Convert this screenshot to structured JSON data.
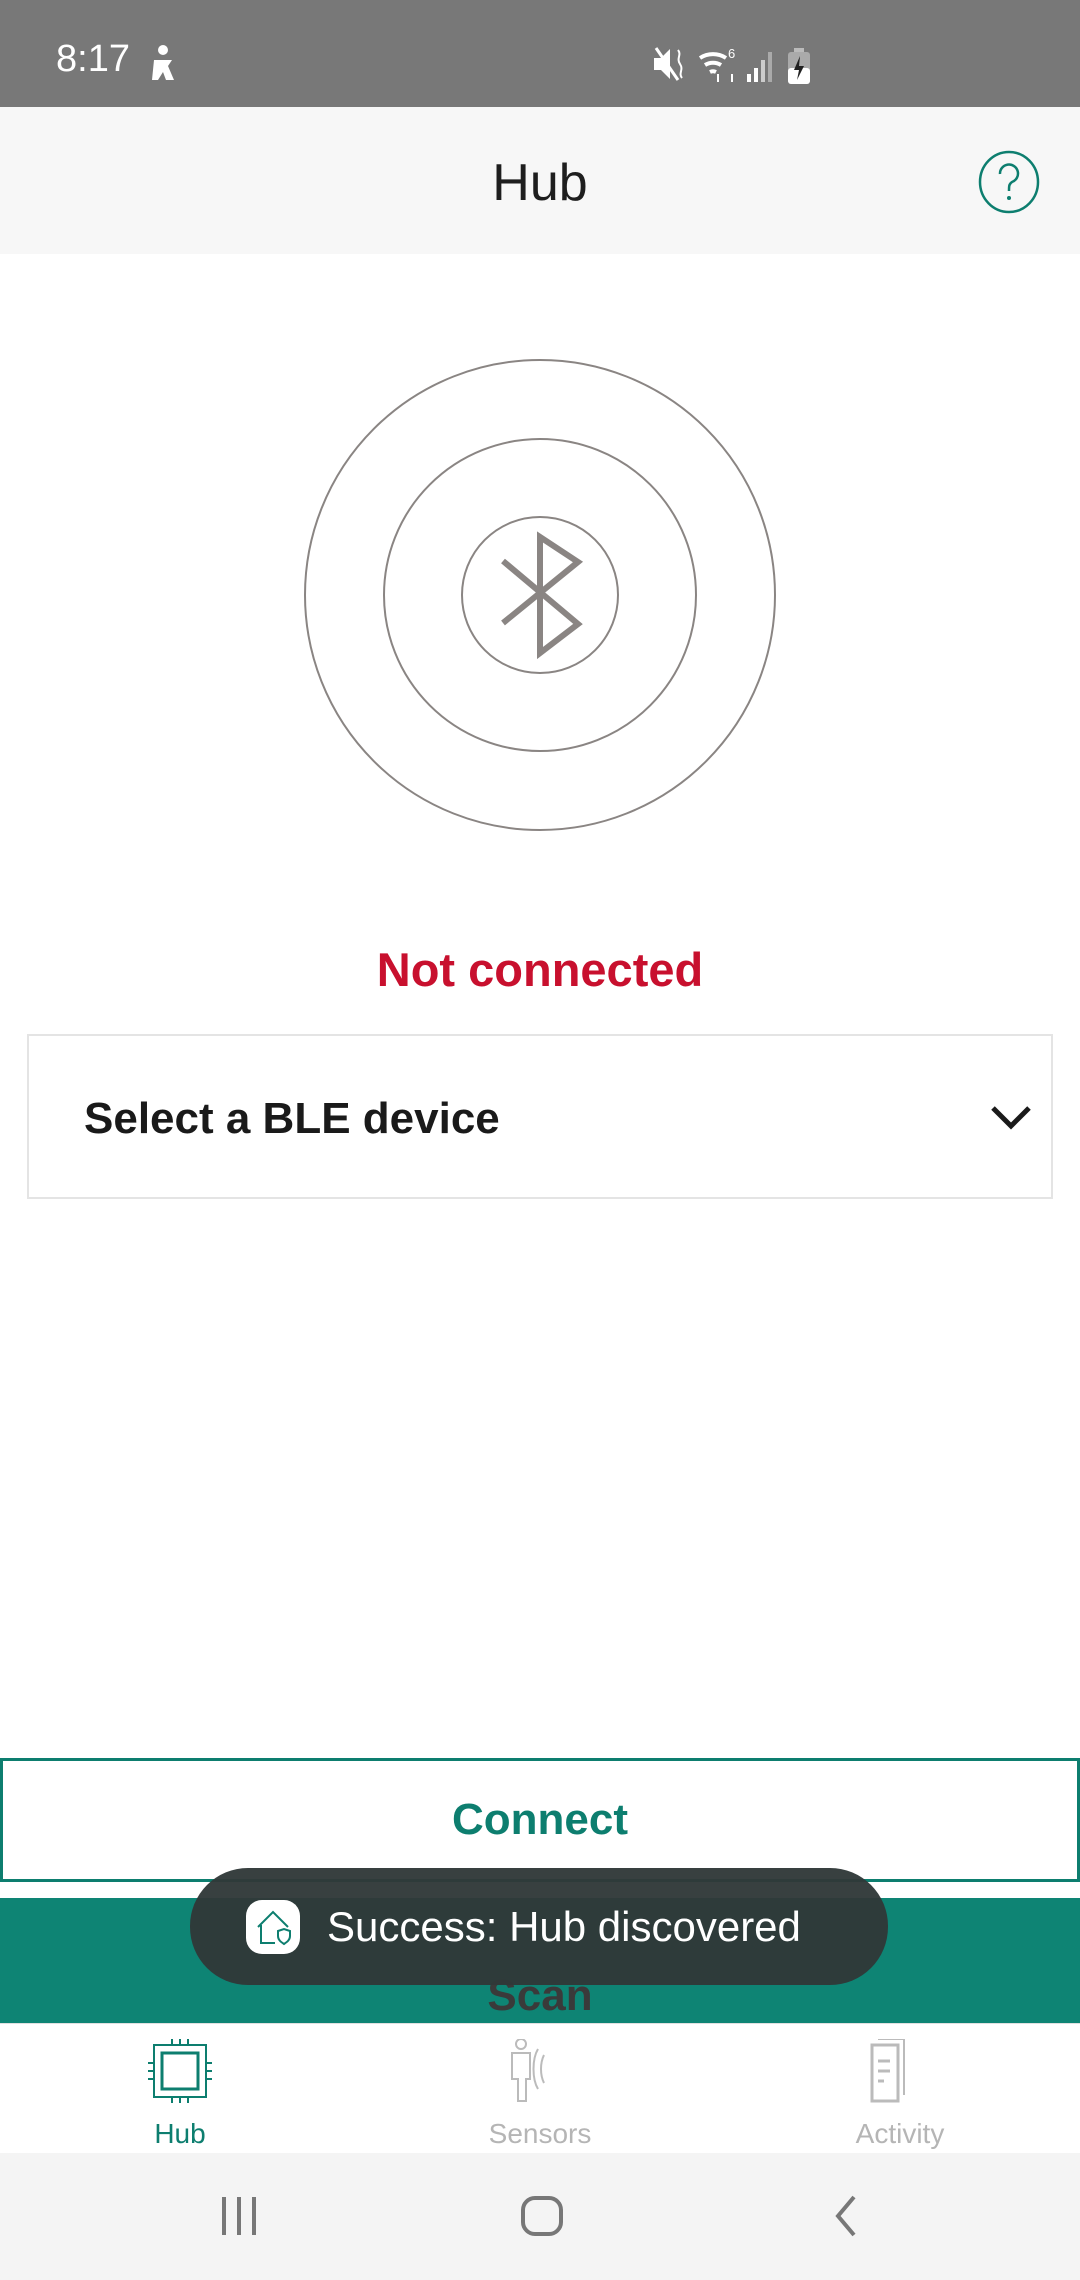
{
  "status_bar": {
    "time": "8:17",
    "icons": [
      "accessibility-icon",
      "mute-icon",
      "wifi-6-icon",
      "signal-icon",
      "battery-charging-icon"
    ]
  },
  "app_bar": {
    "title": "Hub",
    "help_icon": "help-circle-icon"
  },
  "connection": {
    "status": "Not connected",
    "status_color": "#c8102e"
  },
  "device_select": {
    "placeholder": "Select a BLE device"
  },
  "buttons": {
    "connect": "Connect",
    "scan": "Scan"
  },
  "toast": {
    "message": "Success: Hub discovered"
  },
  "bottom_nav": {
    "active": "Hub",
    "accent": "#0d7e6f",
    "items": [
      {
        "label": "Hub",
        "icon": "chip-icon"
      },
      {
        "label": "Sensors",
        "icon": "person-sensor-icon"
      },
      {
        "label": "Activity",
        "icon": "document-icon"
      }
    ]
  }
}
